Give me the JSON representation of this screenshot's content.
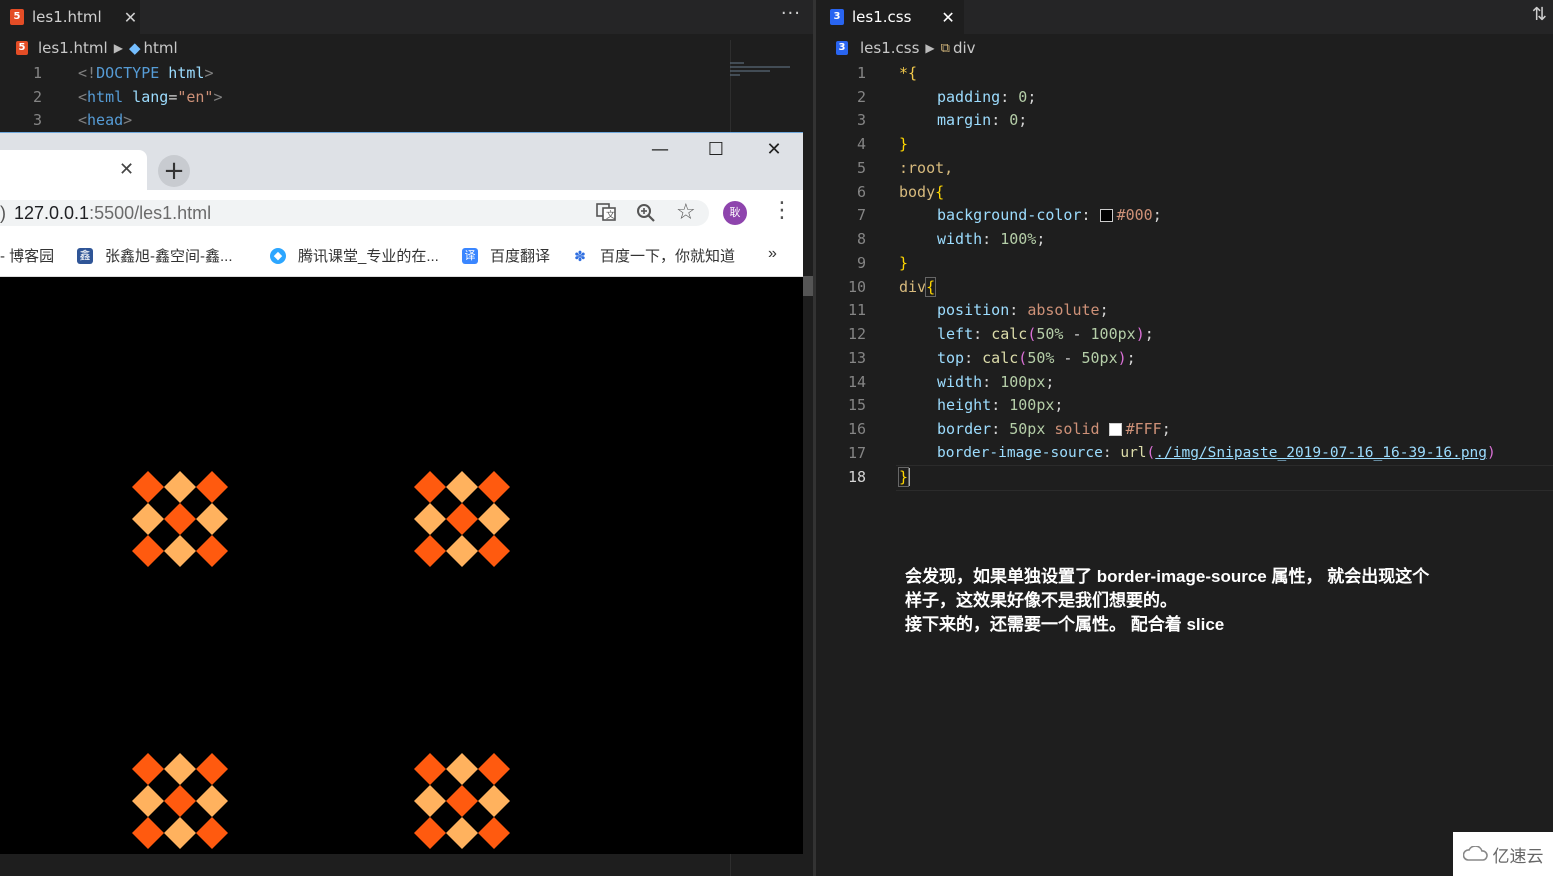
{
  "left_editor": {
    "tab_label": "les1.html",
    "tab_close": "✕",
    "more": "···",
    "breadcrumb": [
      "les1.html",
      "html"
    ],
    "lines": [
      {
        "n": "1",
        "open": "<!",
        "kw": "DOCTYPE",
        "attr": " html",
        "close": ">"
      },
      {
        "n": "2",
        "open": "<",
        "kw": "html",
        "attr": " lang",
        "eq": "=",
        "val": "\"en\"",
        "close": ">"
      },
      {
        "n": "3",
        "open": "<",
        "kw": "head",
        "close": ">"
      }
    ]
  },
  "browser": {
    "tab_close": "✕",
    "new_tab": "+",
    "window_buttons": {
      "minimize": "—",
      "maximize": "☐",
      "close": "✕"
    },
    "url_host": "127.0.0.1",
    "url_rest": ":5500/les1.html",
    "avatar_text": "耿",
    "bookmarks": [
      "- 博客园",
      "张鑫旭-鑫空间-鑫...",
      "腾讯课堂_专业的在...",
      "百度翻译",
      "百度一下，你就知道"
    ],
    "bookmark_more": "»",
    "pattern_colors": {
      "dark": "#ff5a0f",
      "light": "#ffb25e"
    }
  },
  "right_editor": {
    "tab_label": "les1.css",
    "tab_close": "✕",
    "breadcrumb": [
      "les1.css",
      "div"
    ],
    "lines": [
      {
        "n": "1"
      },
      {
        "n": "2"
      },
      {
        "n": "3"
      },
      {
        "n": "4"
      },
      {
        "n": "5"
      },
      {
        "n": "6"
      },
      {
        "n": "7"
      },
      {
        "n": "8"
      },
      {
        "n": "9"
      },
      {
        "n": "10"
      },
      {
        "n": "11"
      },
      {
        "n": "12"
      },
      {
        "n": "13"
      },
      {
        "n": "14"
      },
      {
        "n": "15"
      },
      {
        "n": "16"
      },
      {
        "n": "17"
      },
      {
        "n": "18"
      }
    ],
    "code": {
      "l1": "*{",
      "l2_prop": "padding",
      "l2_val": "0",
      "l3_prop": "margin",
      "l3_val": "0",
      "l4": "}",
      "l5": ":root,",
      "l6_sel": "body",
      "l6_brace": "{",
      "l7_prop": "background-color",
      "l7_val": "#000",
      "l8_prop": "width",
      "l8_val": "100%",
      "l9": "}",
      "l10_sel": "div",
      "l10_brace": "{",
      "l11_prop": "position",
      "l11_val": "absolute",
      "l12_prop": "left",
      "l12_fn": "calc",
      "l12_a": "50%",
      "l12_op": " - ",
      "l12_b": "100px",
      "l13_prop": "top",
      "l13_fn": "calc",
      "l13_a": "50%",
      "l13_op": " - ",
      "l13_b": "50px",
      "l14_prop": "width",
      "l14_val": "100px",
      "l15_prop": "height",
      "l15_val": "100px",
      "l16_prop": "border",
      "l16_num": "50px",
      "l16_kw": "solid",
      "l16_color": "#FFF",
      "l17_prop": "border-image-source",
      "l17_fn": "url",
      "l17_url": "./img/Snipaste_2019-07-16_16-39-16.png",
      "l18": "}"
    },
    "annotation": [
      "会发现，如果单独设置了 border-image-source 属性， 就会出现这个",
      "样子，这效果好像不是我们想要的。",
      "接下来的，还需要一个属性。 配合着 slice"
    ]
  },
  "watermark": "亿速云"
}
